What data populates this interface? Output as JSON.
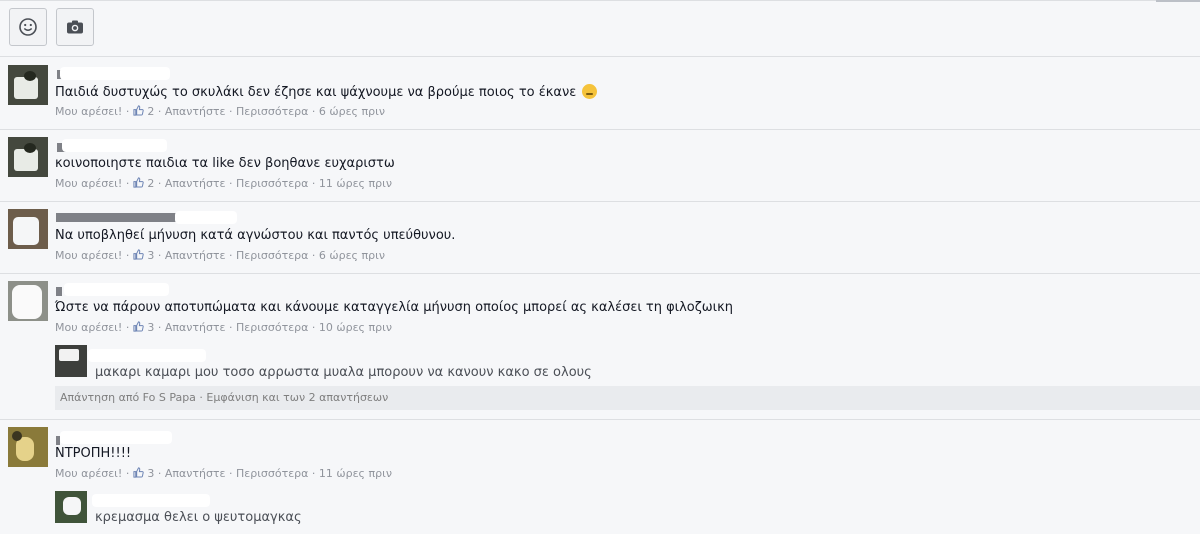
{
  "composer": {
    "emoji_icon": "smiley-face-icon",
    "photo_icon": "camera-icon"
  },
  "comments": [
    {
      "text": "Παιδιά δυστυχώς το σκυλάκι δεν έζησε και ψάχνουμε να βρούμε ποιος το έκανε",
      "emoji": "sad-face-emoji",
      "like": "Μου αρέσει!",
      "likes": "2",
      "reply": "Απαντήστε",
      "more": "Περισσότερα",
      "time": "6 ώρες πριν"
    },
    {
      "text": "κοινοποιηστε παιδια τα like δεν βοηθανε ευχαριστω",
      "like": "Μου αρέσει!",
      "likes": "2",
      "reply": "Απαντήστε",
      "more": "Περισσότερα",
      "time": "11 ώρες πριν"
    },
    {
      "text": "Να υποβληθεί μήνυση κατά αγνώστου και παντός υπεύθυνου.",
      "like": "Μου αρέσει!",
      "likes": "3",
      "reply": "Απαντήστε",
      "more": "Περισσότερα",
      "time": "6 ώρες πριν"
    },
    {
      "text": "Ώστε να πάρουν αποτυπώματα και κάνουμε καταγγελία μήνυση οποίος μπορεί ας καλέσει τη φιλοζωικη",
      "like": "Μου αρέσει!",
      "likes": "3",
      "reply": "Απαντήστε",
      "more": "Περισσότερα",
      "time": "10 ώρες πριν",
      "replies": [
        {
          "text": "μακαρι καμαρι μου τοσο αρρωστα μυαλα μπορουν να κανουν κακο σε ολους"
        }
      ],
      "replies_summary": "Απάντηση από Fo S Papa · Εμφάνιση και των 2 απαντήσεων"
    },
    {
      "text": "ΝΤΡΟΠΗ!!!!",
      "like": "Μου αρέσει!",
      "likes": "3",
      "reply": "Απαντήστε",
      "more": "Περισσότερα",
      "time": "11 ώρες πριν",
      "replies": [
        {
          "text": "κρεμασμα θελει ο ψευτομαγκας"
        }
      ]
    }
  ],
  "separator": " · "
}
